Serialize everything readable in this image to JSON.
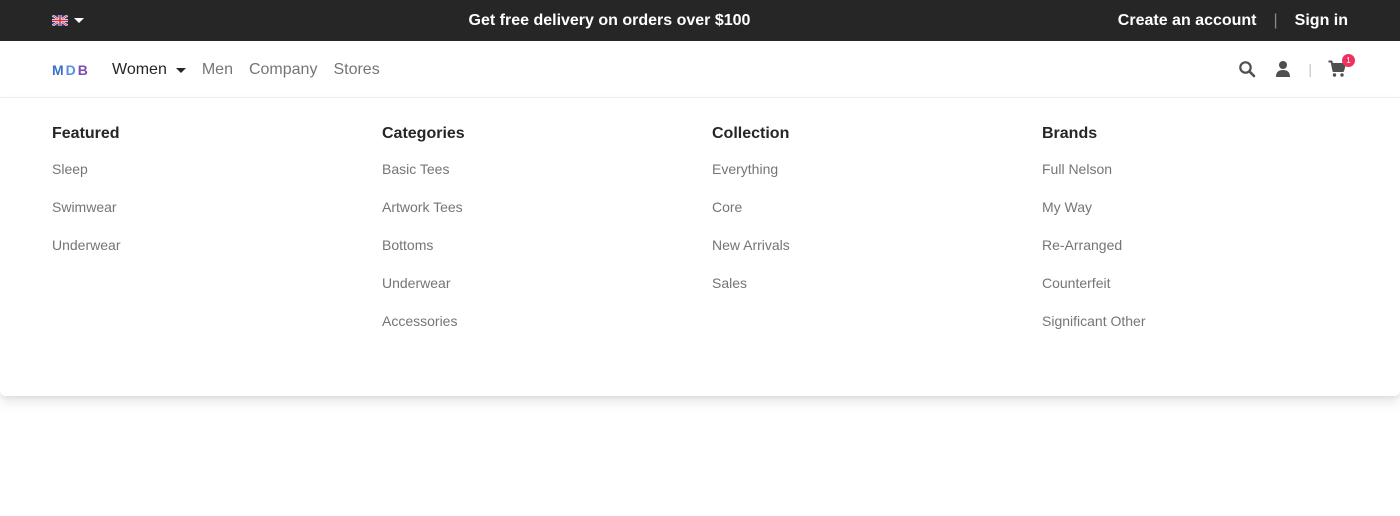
{
  "topbar": {
    "promo": "Get free delivery on orders over $100",
    "create_account": "Create an account",
    "sign_in": "Sign in",
    "language_icon": "uk-flag-icon"
  },
  "navbar": {
    "logo": {
      "m": "M",
      "d": "D",
      "b": "B"
    },
    "links": {
      "women": "Women",
      "men": "Men",
      "company": "Company",
      "stores": "Stores"
    },
    "cart_count": "1"
  },
  "mega_menu": {
    "featured": {
      "title": "Featured",
      "items": [
        "Sleep",
        "Swimwear",
        "Underwear"
      ]
    },
    "categories": {
      "title": "Categories",
      "items": [
        "Basic Tees",
        "Artwork Tees",
        "Bottoms",
        "Underwear",
        "Accessories"
      ]
    },
    "collection": {
      "title": "Collection",
      "items": [
        "Everything",
        "Core",
        "New Arrivals",
        "Sales"
      ]
    },
    "brands": {
      "title": "Brands",
      "items": [
        "Full Nelson",
        "My Way",
        "Re-Arranged",
        "Counterfeit",
        "Significant Other"
      ]
    }
  },
  "colors": {
    "topbar_bg": "#262626",
    "badge": "#f0315f",
    "muted_text": "#757575",
    "logo_blue": "#3b71ca",
    "logo_purple": "#7a4fb0"
  }
}
